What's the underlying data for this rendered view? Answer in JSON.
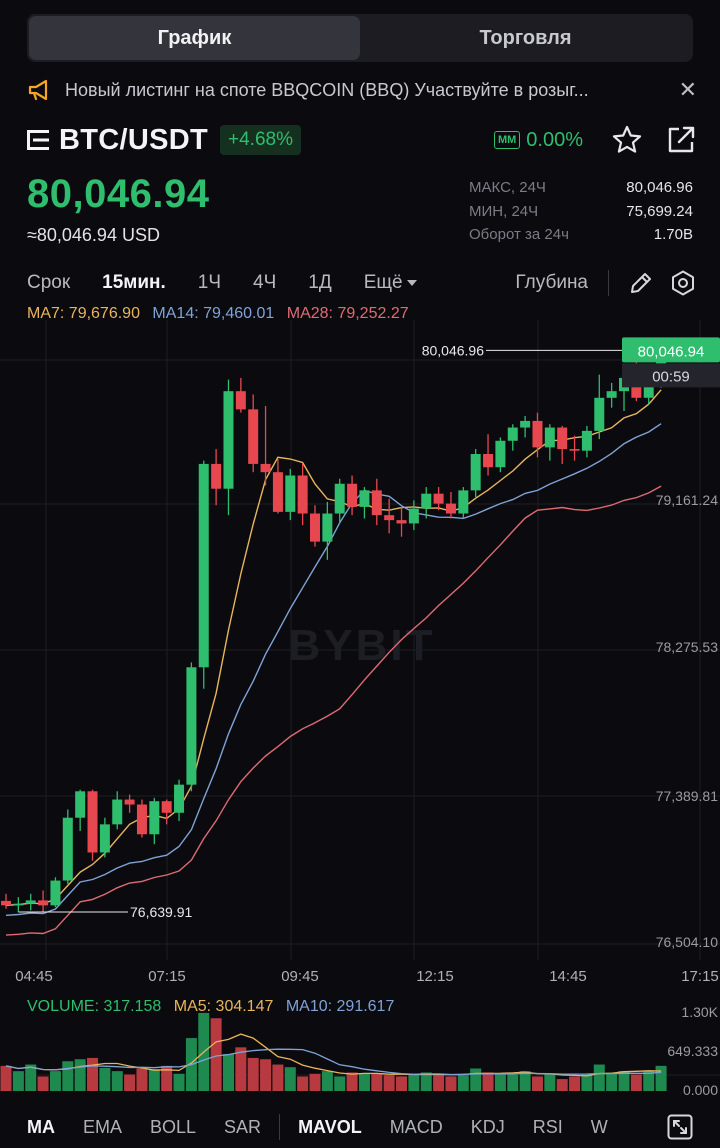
{
  "tabs": [
    {
      "label": "График",
      "active": true
    },
    {
      "label": "Торговля",
      "active": false
    }
  ],
  "announcement": {
    "text": "Новый листинг на споте  BBQCOIN (BBQ)  Участвуйте в розыг...",
    "icon": "megaphone-icon"
  },
  "pair": {
    "name": "BTC/USDT",
    "change": "+4.68%",
    "mm_badge": "MM",
    "mm_value": "0.00%"
  },
  "price": {
    "last": "80,046.94",
    "fiat": "≈80,046.94 USD"
  },
  "stats": [
    {
      "label": "МАКС, 24Ч",
      "value": "80,046.96"
    },
    {
      "label": "МИН, 24Ч",
      "value": "75,699.24"
    },
    {
      "label": "Оборот за 24ч",
      "value": "1.70B"
    }
  ],
  "intervals": {
    "label": "Срок",
    "items": [
      "15мин.",
      "1Ч",
      "4Ч",
      "1Д"
    ],
    "active": "15мин.",
    "more": "Ещё",
    "depth": "Глубина"
  },
  "ma": {
    "ma7": "MA7: 79,676.90",
    "ma14": "MA14: 79,460.01",
    "ma28": "MA28: 79,252.27"
  },
  "volume": {
    "vol": "VOLUME: 317.158",
    "ma5": "MA5: 304.147",
    "ma10": "MA10: 291.617"
  },
  "chart": {
    "price_ticks": [
      "79,161.24",
      "78,275.53",
      "77,389.81",
      "76,504.10"
    ],
    "time_ticks": [
      "04:45",
      "07:15",
      "09:45",
      "12:15",
      "14:45",
      "17:15"
    ],
    "high_label": "80,046.96",
    "low_label": "76,639.91",
    "last_tag": "80,046.94",
    "countdown": "00:59",
    "vol_ticks": [
      "1.30K",
      "649.333",
      "0.000"
    ],
    "watermark": "BYBIT"
  },
  "indicators": [
    "MA",
    "EMA",
    "BOLL",
    "SAR",
    "MAVOL",
    "MACD",
    "KDJ",
    "RSI",
    "W"
  ],
  "colors": {
    "up": "#2fbd6e",
    "down": "#e74850",
    "ma7": "#e9b55a",
    "ma14": "#7fa3d6",
    "ma28": "#e06a74",
    "bg": "#0b0b0f"
  },
  "chart_data": {
    "type": "candlestick",
    "interval": "15m",
    "candles": [
      [
        76717,
        76760,
        76670,
        76690
      ],
      [
        76690,
        76740,
        76650,
        76700
      ],
      [
        76700,
        76760,
        76660,
        76720
      ],
      [
        76720,
        76780,
        76650,
        76690
      ],
      [
        76690,
        76860,
        76680,
        76840
      ],
      [
        76840,
        77270,
        76820,
        77220
      ],
      [
        77220,
        77390,
        77140,
        77380
      ],
      [
        77380,
        77390,
        76960,
        77010
      ],
      [
        77010,
        77220,
        76980,
        77180
      ],
      [
        77180,
        77380,
        77150,
        77330
      ],
      [
        77330,
        77360,
        77250,
        77300
      ],
      [
        77300,
        77330,
        77100,
        77120
      ],
      [
        77120,
        77340,
        77060,
        77320
      ],
      [
        77320,
        77330,
        77180,
        77250
      ],
      [
        77250,
        77450,
        77200,
        77420
      ],
      [
        77420,
        78160,
        77380,
        78130
      ],
      [
        78130,
        79380,
        78000,
        79360
      ],
      [
        79360,
        79450,
        79110,
        79210
      ],
      [
        79210,
        79870,
        79050,
        79800
      ],
      [
        79800,
        79880,
        79670,
        79690
      ],
      [
        79690,
        79780,
        79310,
        79360
      ],
      [
        79360,
        79710,
        79230,
        79310
      ],
      [
        79310,
        79390,
        79060,
        79070
      ],
      [
        79070,
        79330,
        79020,
        79290
      ],
      [
        79290,
        79360,
        78990,
        79060
      ],
      [
        79060,
        79110,
        78860,
        78890
      ],
      [
        78890,
        79130,
        78780,
        79060
      ],
      [
        79060,
        79270,
        79000,
        79240
      ],
      [
        79240,
        79290,
        79050,
        79100
      ],
      [
        79100,
        79220,
        79030,
        79200
      ],
      [
        79200,
        79270,
        78990,
        79050
      ],
      [
        79050,
        79150,
        78940,
        79020
      ],
      [
        79020,
        79100,
        78920,
        79000
      ],
      [
        79000,
        79140,
        78960,
        79090
      ],
      [
        79090,
        79220,
        79030,
        79180
      ],
      [
        79180,
        79220,
        79080,
        79120
      ],
      [
        79120,
        79190,
        79030,
        79060
      ],
      [
        79060,
        79220,
        79030,
        79200
      ],
      [
        79200,
        79450,
        79160,
        79420
      ],
      [
        79420,
        79540,
        79290,
        79340
      ],
      [
        79340,
        79520,
        79310,
        79500
      ],
      [
        79500,
        79600,
        79440,
        79580
      ],
      [
        79580,
        79650,
        79520,
        79620
      ],
      [
        79620,
        79670,
        79400,
        79460
      ],
      [
        79460,
        79600,
        79380,
        79580
      ],
      [
        79580,
        79590,
        79360,
        79450
      ],
      [
        79450,
        79530,
        79380,
        79440
      ],
      [
        79440,
        79590,
        79400,
        79560
      ],
      [
        79560,
        79900,
        79510,
        79760
      ],
      [
        79760,
        79850,
        79700,
        79800
      ],
      [
        79800,
        79930,
        79680,
        79880
      ],
      [
        79880,
        80010,
        79740,
        79760
      ],
      [
        79760,
        79950,
        79720,
        79850
      ],
      [
        79850,
        80046.96,
        79820,
        80046.94
      ]
    ],
    "volume": [
      38,
      30,
      40,
      22,
      30,
      45,
      48,
      50,
      35,
      30,
      25,
      34,
      33,
      38,
      26,
      80,
      118,
      110,
      56,
      66,
      50,
      48,
      40,
      36,
      22,
      26,
      30,
      22,
      28,
      27,
      26,
      24,
      22,
      26,
      28,
      25,
      22,
      24,
      34,
      28,
      26,
      25,
      30,
      22,
      26,
      18,
      22,
      26,
      40,
      28,
      30,
      25,
      30,
      38
    ],
    "y_range": [
      76420,
      80170
    ]
  }
}
